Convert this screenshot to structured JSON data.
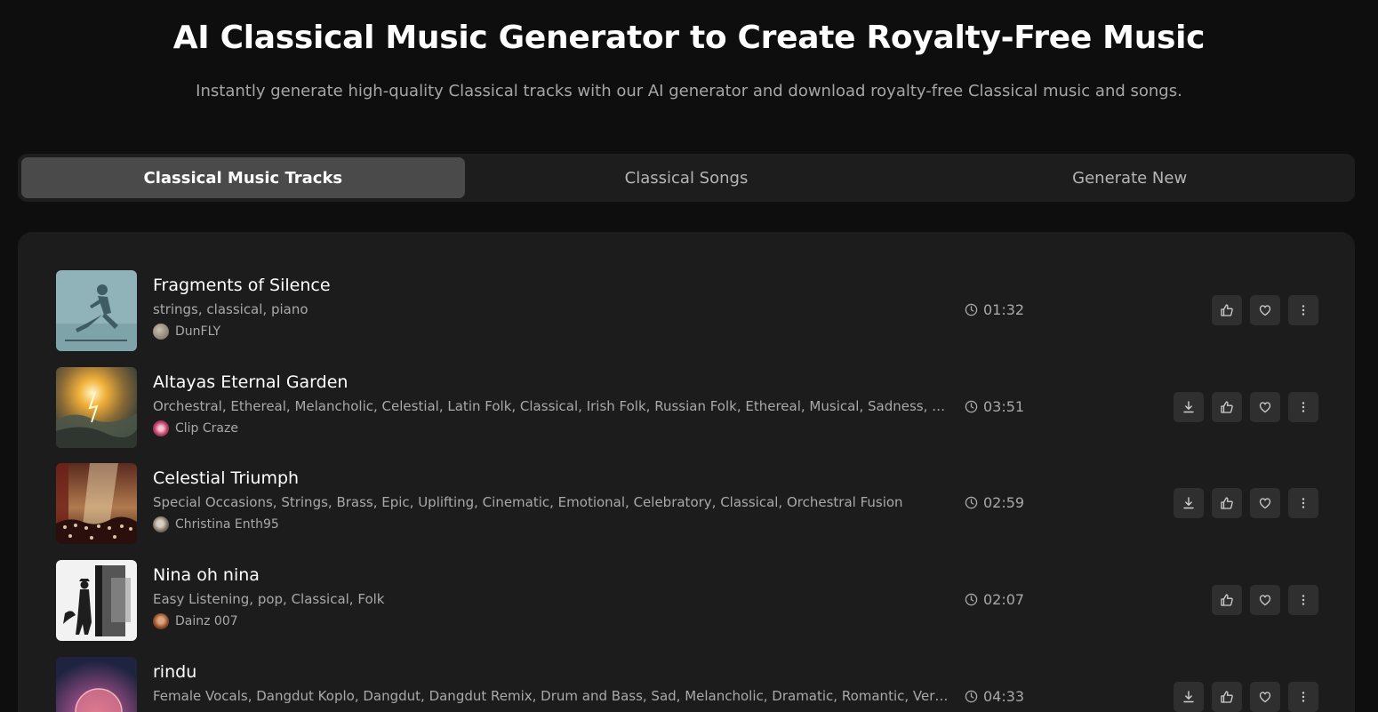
{
  "header": {
    "title": "AI Classical Music Generator to Create Royalty-Free Music",
    "subtitle": "Instantly generate high-quality Classical tracks with our AI generator and download royalty-free Classical music and songs."
  },
  "tabs": [
    {
      "label": "Classical Music Tracks",
      "active": true
    },
    {
      "label": "Classical Songs",
      "active": false
    },
    {
      "label": "Generate New",
      "active": false
    }
  ],
  "tracks": [
    {
      "title": "Fragments of Silence",
      "tags": "strings, classical, piano",
      "author": "DunFLY",
      "duration": "01:32",
      "downloadable": false
    },
    {
      "title": "Altayas Eternal Garden",
      "tags": "Orchestral, Ethereal, Melancholic, Celestial, Latin Folk, Classical, Irish Folk, Russian Folk, Ethereal, Musical, Sadness, Romantic, Aggressive",
      "author": "Clip Craze",
      "duration": "03:51",
      "downloadable": true
    },
    {
      "title": "Celestial Triumph",
      "tags": "Special Occasions, Strings, Brass, Epic, Uplifting, Cinematic, Emotional, Celebratory, Classical, Orchestral Fusion",
      "author": "Christina Enth95",
      "duration": "02:59",
      "downloadable": true
    },
    {
      "title": "Nina oh nina",
      "tags": "Easy Listening, pop, Classical, Folk",
      "author": "Dainz 007",
      "duration": "02:07",
      "downloadable": false
    },
    {
      "title": "rindu",
      "tags": "Female Vocals, Dangdut Koplo, Dangdut, Dangdut Remix, Drum and Bass, Sad, Melancholic, Dramatic, Romantic, Very Slow, Emotional",
      "author": "",
      "duration": "04:33",
      "downloadable": true
    }
  ],
  "icons": {
    "download": "download-icon",
    "like": "thumbs-up-icon",
    "favorite": "heart-icon",
    "more": "more-vertical-icon",
    "clock": "clock-icon"
  },
  "colors": {
    "background": "#0e0e0e",
    "panel": "#1c1c1c",
    "tab_active": "#4a4a4a",
    "button": "#2f2f2f"
  }
}
